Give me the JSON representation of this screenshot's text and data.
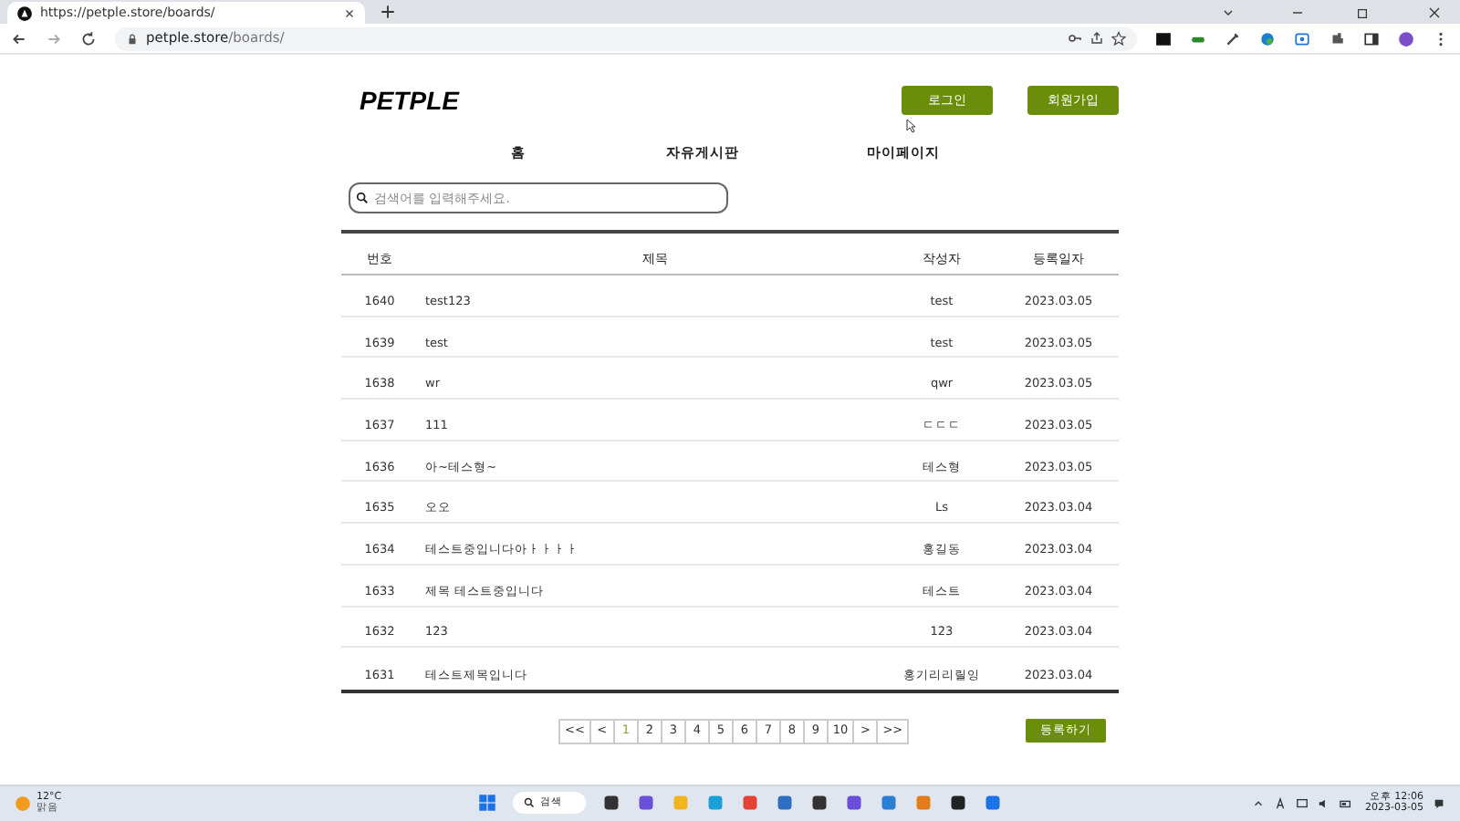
{
  "browser": {
    "tab_title": "https://petple.store/boards/",
    "url_host": "petple.store",
    "url_path": "/boards/"
  },
  "header": {
    "logo": "PETPLE",
    "buttons": [
      "로그인",
      "회원가입"
    ]
  },
  "nav": [
    {
      "label": "홈"
    },
    {
      "label": "자유게시판"
    },
    {
      "label": "마이페이지"
    }
  ],
  "search": {
    "placeholder": "검색어를 입력해주세요."
  },
  "table": {
    "columns": [
      "번호",
      "제목",
      "작성자",
      "등록일자"
    ],
    "rows": [
      [
        "1640",
        "test123",
        "test",
        "2023.03.05"
      ],
      [
        "1639",
        "test",
        "test",
        "2023.03.05"
      ],
      [
        "1638",
        "wr",
        "qwr",
        "2023.03.05"
      ],
      [
        "1637",
        "111",
        "ㄷㄷㄷ",
        "2023.03.05"
      ],
      [
        "1636",
        "아~테스형~",
        "테스형",
        "2023.03.05"
      ],
      [
        "1635",
        "오오",
        "Ls",
        "2023.03.04"
      ],
      [
        "1634",
        "테스트중입니다아ㅏㅏㅏㅏ",
        "홍길동",
        "2023.03.04"
      ],
      [
        "1633",
        "제목 테스트중입니다",
        "테스트",
        "2023.03.04"
      ],
      [
        "1632",
        "123",
        "123",
        "2023.03.04"
      ],
      [
        "1631",
        "테스트제목입니다",
        "홍기리리릴잉",
        "2023.03.04"
      ]
    ]
  },
  "pagination": [
    {
      "label": "<<",
      "selected": false
    },
    {
      "label": "<",
      "selected": false
    },
    {
      "label": "1",
      "selected": true
    },
    {
      "label": "2",
      "selected": false
    },
    {
      "label": "3",
      "selected": false
    },
    {
      "label": "4",
      "selected": false
    },
    {
      "label": "5",
      "selected": false
    },
    {
      "label": "6",
      "selected": false
    },
    {
      "label": "7",
      "selected": false
    },
    {
      "label": "8",
      "selected": false
    },
    {
      "label": "9",
      "selected": false
    },
    {
      "label": "10",
      "selected": false
    },
    {
      "label": ">",
      "selected": false
    },
    {
      "label": ">>",
      "selected": false
    }
  ],
  "write_button": "등록하기",
  "taskbar": {
    "temperature": "12°C",
    "weather": "맑음",
    "search": "검색",
    "time": "오후 12:06",
    "date": "2023-03-05"
  }
}
